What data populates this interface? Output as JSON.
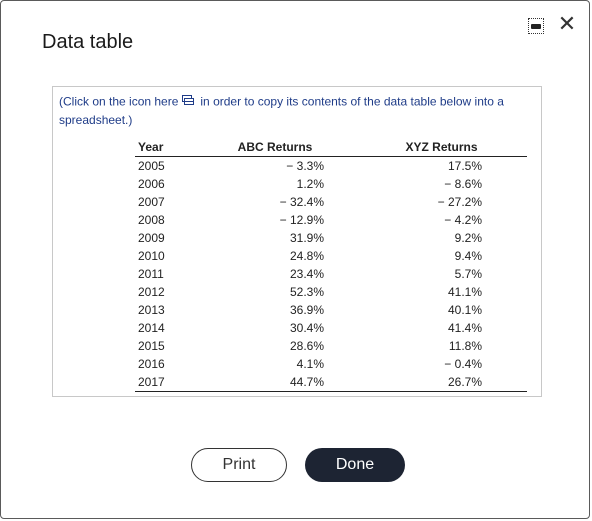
{
  "dialog": {
    "title": "Data table",
    "minimize_icon": "minimize-icon",
    "close_icon": "close-icon",
    "close_glyph": "✕"
  },
  "instructions": {
    "before": "(Click on the icon here",
    "after": "in order to copy its contents of the data table below into a spreadsheet.)",
    "icon": "copy-spreadsheet-icon"
  },
  "table": {
    "headers": [
      "Year",
      "ABC Returns",
      "XYZ Returns"
    ],
    "rows": [
      [
        "2005",
        "− 3.3%",
        "17.5%"
      ],
      [
        "2006",
        "1.2%",
        "− 8.6%"
      ],
      [
        "2007",
        "− 32.4%",
        "− 27.2%"
      ],
      [
        "2008",
        "− 12.9%",
        "− 4.2%"
      ],
      [
        "2009",
        "31.9%",
        "9.2%"
      ],
      [
        "2010",
        "24.8%",
        "9.4%"
      ],
      [
        "2011",
        "23.4%",
        "5.7%"
      ],
      [
        "2012",
        "52.3%",
        "41.1%"
      ],
      [
        "2013",
        "36.9%",
        "40.1%"
      ],
      [
        "2014",
        "30.4%",
        "41.4%"
      ],
      [
        "2015",
        "28.6%",
        "11.8%"
      ],
      [
        "2016",
        "4.1%",
        "− 0.4%"
      ],
      [
        "2017",
        "44.7%",
        "26.7%"
      ]
    ]
  },
  "buttons": {
    "print": "Print",
    "done": "Done"
  },
  "colors": {
    "instruction_text": "#1f3c88",
    "done_bg": "#1d2433",
    "done_text": "#ffffff"
  }
}
